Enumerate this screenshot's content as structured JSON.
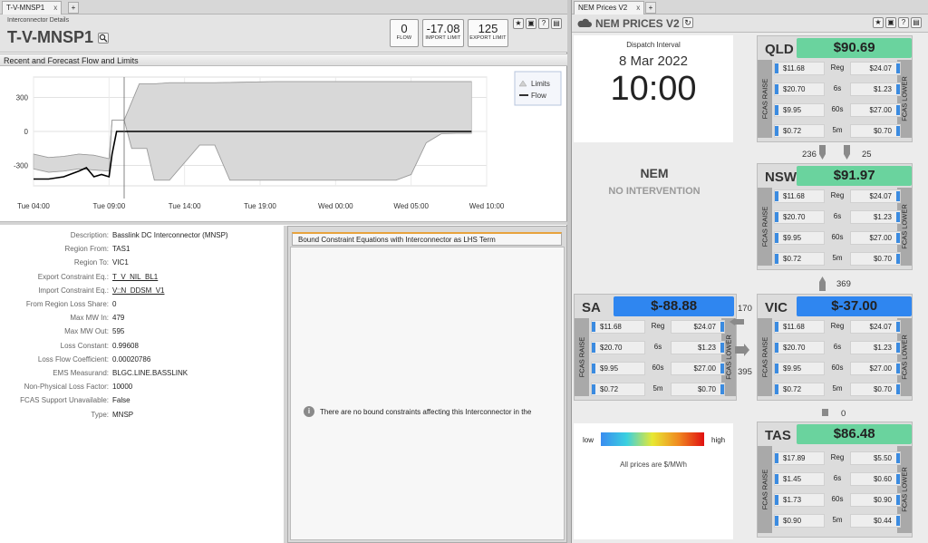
{
  "left_tab": {
    "label": "T-V-MNSP1",
    "close": "x",
    "add": "+"
  },
  "right_tab": {
    "label": "NEM Prices V2",
    "close": "x",
    "add": "+"
  },
  "interconnector": {
    "subtitle": "Interconnector Details",
    "title": "T-V-MNSP1",
    "flow": {
      "value": "0",
      "label": "FLOW"
    },
    "import_limit": {
      "value": "-17.08",
      "label": "IMPORT LIMIT"
    },
    "export_limit": {
      "value": "125",
      "label": "EXPORT LIMIT"
    }
  },
  "chart_section_title": "Recent and Forecast Flow and Limits",
  "chart_data": {
    "type": "line",
    "xlabel": "",
    "ylabel": "",
    "x_ticks": [
      "Tue 04:00",
      "Tue 09:00",
      "Tue 14:00",
      "Tue 19:00",
      "Wed 00:00",
      "Wed 05:00",
      "Wed 10:00"
    ],
    "y_ticks": [
      "300",
      "0",
      "-300"
    ],
    "ylim": [
      -480,
      480
    ],
    "legend": [
      {
        "name": "Limits",
        "color": "#d0d0d0"
      },
      {
        "name": "Flow",
        "color": "#000000"
      }
    ],
    "legend_position": "top-right",
    "current_time_marker": "Tue 10:00",
    "series": [
      {
        "name": "Flow",
        "x_hours": [
          0,
          1,
          2,
          3,
          3.5,
          4,
          4.5,
          5,
          5.2,
          5.5,
          6,
          8,
          12,
          16,
          20,
          24,
          29
        ],
        "values": [
          -420,
          -420,
          -400,
          -350,
          -320,
          -400,
          -380,
          -400,
          -200,
          0,
          0,
          0,
          0,
          0,
          0,
          0,
          0
        ]
      },
      {
        "name": "Limits upper",
        "x_hours": [
          0,
          1,
          2,
          3,
          4,
          5,
          5.2,
          6,
          7,
          8,
          9,
          10,
          11,
          12,
          16,
          20,
          24,
          28,
          29
        ],
        "values": [
          -200,
          -230,
          -220,
          -200,
          -210,
          -240,
          100,
          100,
          420,
          420,
          430,
          430,
          430,
          430,
          440,
          440,
          440,
          440,
          440
        ]
      },
      {
        "name": "Limits lower",
        "x_hours": [
          0,
          1,
          2,
          3,
          4,
          5,
          5.2,
          6,
          6.5,
          7,
          7.5,
          8,
          8.5,
          9,
          11,
          12,
          13,
          18,
          21,
          22,
          23,
          24,
          25,
          26,
          27,
          28,
          29
        ],
        "values": [
          -330,
          -360,
          -350,
          -330,
          -340,
          -350,
          100,
          100,
          -150,
          -150,
          -150,
          -430,
          -430,
          -430,
          -120,
          -120,
          -430,
          -430,
          -430,
          -430,
          -430,
          -430,
          -380,
          -100,
          -20,
          -17,
          -17
        ]
      }
    ]
  },
  "details": [
    {
      "key": "Description:",
      "value": "Basslink DC Interconnector (MNSP)",
      "link": false
    },
    {
      "key": "Region From:",
      "value": "TAS1",
      "link": false
    },
    {
      "key": "Region To:",
      "value": "VIC1",
      "link": false
    },
    {
      "key": "Export Constraint Eq.:",
      "value": "T_V_NIL_BL1",
      "link": true
    },
    {
      "key": "Import Constraint Eq.:",
      "value": "V::N_DDSM_V1",
      "link": true
    },
    {
      "key": "From Region Loss Share:",
      "value": "0",
      "link": false
    },
    {
      "key": "Max MW In:",
      "value": "479",
      "link": false
    },
    {
      "key": "Max MW Out:",
      "value": "595",
      "link": false
    },
    {
      "key": "Loss Constant:",
      "value": "0.99608",
      "link": false
    },
    {
      "key": "Loss Flow Coefficient:",
      "value": "0.00020786",
      "link": false
    },
    {
      "key": "EMS Measurand:",
      "value": "BLGC.LINE.BASSLINK",
      "link": false
    },
    {
      "key": "Non-Physical Loss Factor:",
      "value": "10000",
      "link": false
    },
    {
      "key": "FCAS Support Unavailable:",
      "value": "False",
      "link": false
    },
    {
      "key": "Type:",
      "value": "MNSP",
      "link": false
    }
  ],
  "bound_tab": "Bound Constraint Equations with Interconnector as LHS Term",
  "bound_message": "There are no bound constraints affecting this Interconnector in the",
  "nem": {
    "title": "NEM PRICES V2",
    "dispatch_label": "Dispatch Interval",
    "date": "8 Mar 2022",
    "time": "10:00",
    "market": "NEM",
    "intervention": "NO INTERVENTION",
    "legend_low": "low",
    "legend_high": "high",
    "legend_note": "All prices are $/MWh",
    "fcas_raise": "FCAS RAISE",
    "fcas_lower": "FCAS LOWER",
    "services": [
      "Reg",
      "6s",
      "60s",
      "5m"
    ],
    "regions": {
      "qld": {
        "name": "QLD",
        "price": "$90.69",
        "color": "#6ad39e",
        "raise": [
          "$11.68",
          "$20.70",
          "$9.95",
          "$0.72"
        ],
        "lower": [
          "$24.07",
          "$1.23",
          "$27.00",
          "$0.70"
        ]
      },
      "nsw": {
        "name": "NSW",
        "price": "$91.97",
        "color": "#6ad39e",
        "raise": [
          "$11.68",
          "$20.70",
          "$9.95",
          "$0.72"
        ],
        "lower": [
          "$24.07",
          "$1.23",
          "$27.00",
          "$0.70"
        ]
      },
      "sa": {
        "name": "SA",
        "price": "$-88.88",
        "color": "#2f86f0",
        "raise": [
          "$11.68",
          "$20.70",
          "$9.95",
          "$0.72"
        ],
        "lower": [
          "$24.07",
          "$1.23",
          "$27.00",
          "$0.70"
        ]
      },
      "vic": {
        "name": "VIC",
        "price": "$-37.00",
        "color": "#2f86f0",
        "raise": [
          "$11.68",
          "$20.70",
          "$9.95",
          "$0.72"
        ],
        "lower": [
          "$24.07",
          "$1.23",
          "$27.00",
          "$0.70"
        ]
      },
      "tas": {
        "name": "TAS",
        "price": "$86.48",
        "color": "#6ad39e",
        "raise": [
          "$17.89",
          "$1.45",
          "$1.73",
          "$0.90"
        ],
        "lower": [
          "$5.50",
          "$0.60",
          "$0.90",
          "$0.44"
        ]
      }
    },
    "flows": {
      "qld_nsw_left": "236",
      "qld_nsw_right": "25",
      "nsw_vic": "369",
      "sa_vic_top": "170",
      "sa_vic_bottom": "395",
      "vic_tas": "0"
    }
  }
}
